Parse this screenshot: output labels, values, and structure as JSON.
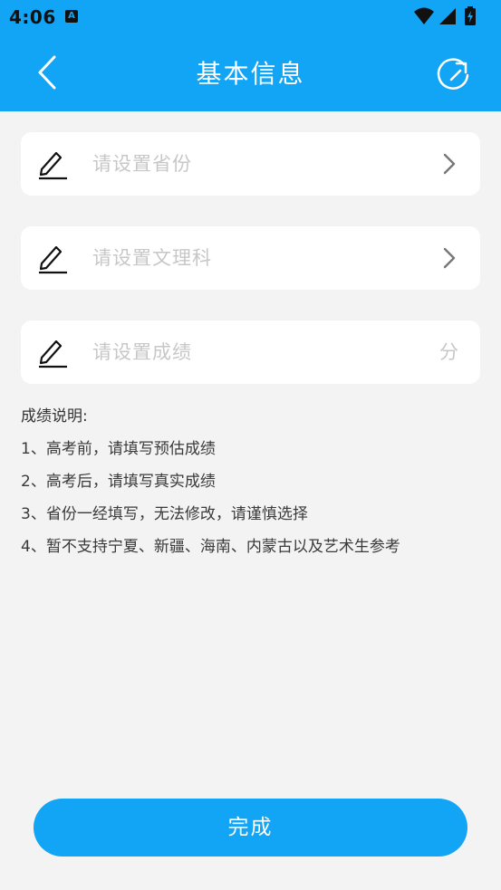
{
  "status_bar": {
    "time": "4:06",
    "app_icon_letter": "A",
    "icons": [
      "wifi-icon",
      "signal-icon",
      "battery-charging-icon"
    ]
  },
  "header": {
    "title": "基本信息",
    "back_icon": "back-arrow-icon",
    "refresh_icon": "refresh-icon"
  },
  "fields": {
    "province": {
      "placeholder": "请设置省份",
      "icon": "edit-icon",
      "trailing": "chevron-right-icon"
    },
    "subject": {
      "placeholder": "请设置文理科",
      "icon": "edit-icon",
      "trailing": "chevron-right-icon"
    },
    "score": {
      "placeholder": "请设置成绩",
      "icon": "edit-icon",
      "unit": "分"
    }
  },
  "notes": {
    "title": "成绩说明:",
    "lines": [
      "1、高考前，请填写预估成绩",
      "2、高考后，请填写真实成绩",
      "3、省份一经填写，无法修改，请谨慎选择",
      "4、暂不支持宁夏、新疆、海南、内蒙古以及艺术生参考"
    ]
  },
  "actions": {
    "done_label": "完成"
  },
  "colors": {
    "primary": "#12a4f5",
    "background": "#f4f3f3",
    "placeholder": "#c7c7c7"
  }
}
